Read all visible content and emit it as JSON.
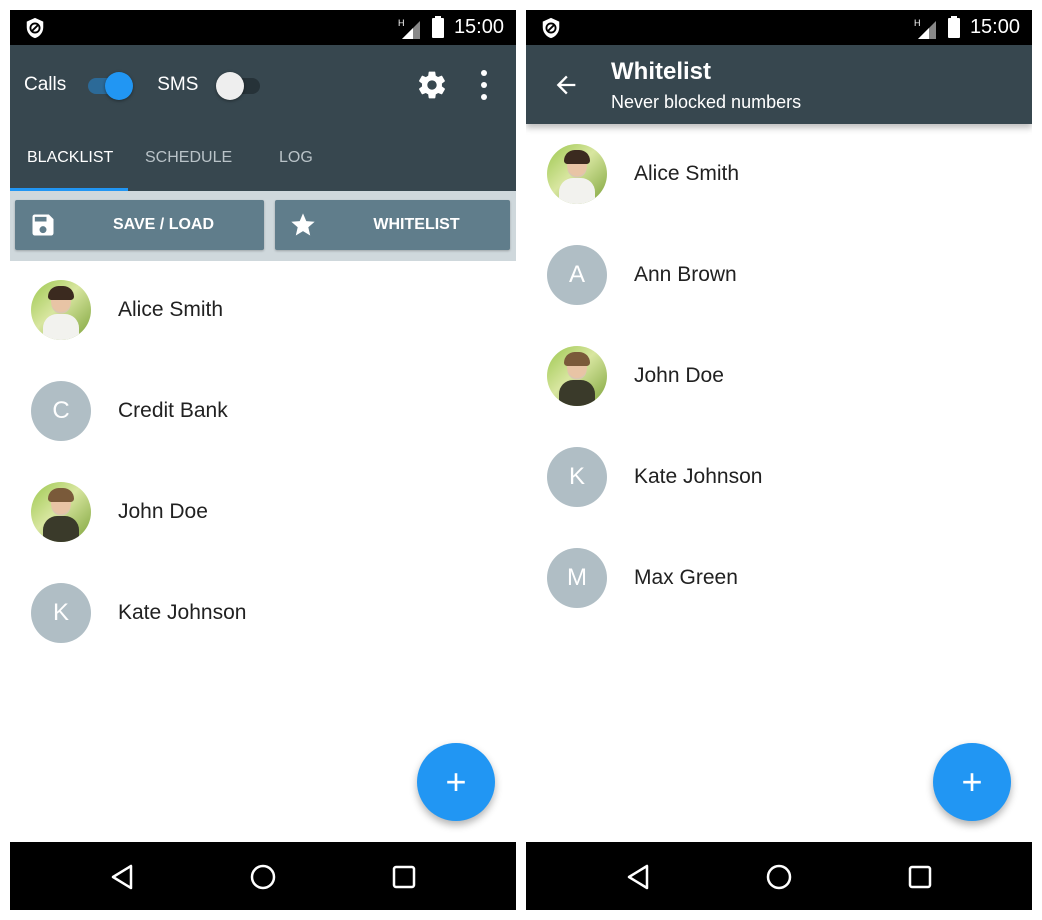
{
  "status_bar": {
    "time": "15:00",
    "network_type": "H",
    "icons": [
      "shield-block-icon",
      "signal-icon",
      "battery-icon"
    ]
  },
  "left_screen": {
    "toggles": [
      {
        "label": "Calls",
        "state": "on"
      },
      {
        "label": "SMS",
        "state": "off"
      }
    ],
    "toolbar_icons": [
      "gear-icon",
      "more-vert-icon"
    ],
    "tabs": [
      {
        "label": "BLACKLIST",
        "active": true
      },
      {
        "label": "SCHEDULE",
        "active": false
      },
      {
        "label": "LOG",
        "active": false
      }
    ],
    "actions": {
      "save_load": {
        "label": "SAVE / LOAD",
        "icon": "floppy-disk-icon"
      },
      "whitelist": {
        "label": "WHITELIST",
        "icon": "star-icon"
      }
    },
    "contacts": [
      {
        "name": "Alice Smith",
        "avatar": "photo",
        "initial": ""
      },
      {
        "name": "Credit Bank",
        "avatar": "letter",
        "initial": "C"
      },
      {
        "name": "John Doe",
        "avatar": "photo",
        "initial": ""
      },
      {
        "name": "Kate Johnson",
        "avatar": "letter",
        "initial": "K"
      }
    ],
    "fab": {
      "label": "+",
      "icon": "add-icon"
    }
  },
  "right_screen": {
    "title": "Whitelist",
    "subtitle": "Never blocked numbers",
    "back_icon": "arrow-back-icon",
    "contacts": [
      {
        "name": "Alice Smith",
        "avatar": "photo",
        "initial": ""
      },
      {
        "name": "Ann Brown",
        "avatar": "letter",
        "initial": "A"
      },
      {
        "name": "John Doe",
        "avatar": "photo",
        "initial": ""
      },
      {
        "name": "Kate Johnson",
        "avatar": "letter",
        "initial": "K"
      },
      {
        "name": "Max Green",
        "avatar": "letter",
        "initial": "M"
      }
    ],
    "fab": {
      "label": "+",
      "icon": "add-icon"
    }
  },
  "nav_bar": {
    "buttons": [
      "back",
      "home",
      "recents"
    ]
  },
  "colors": {
    "appbar": "#37474f",
    "accent": "#2196f3",
    "action_button": "#607d8b",
    "action_strip": "#cfd8dc",
    "avatar_placeholder": "#b0bec5"
  }
}
